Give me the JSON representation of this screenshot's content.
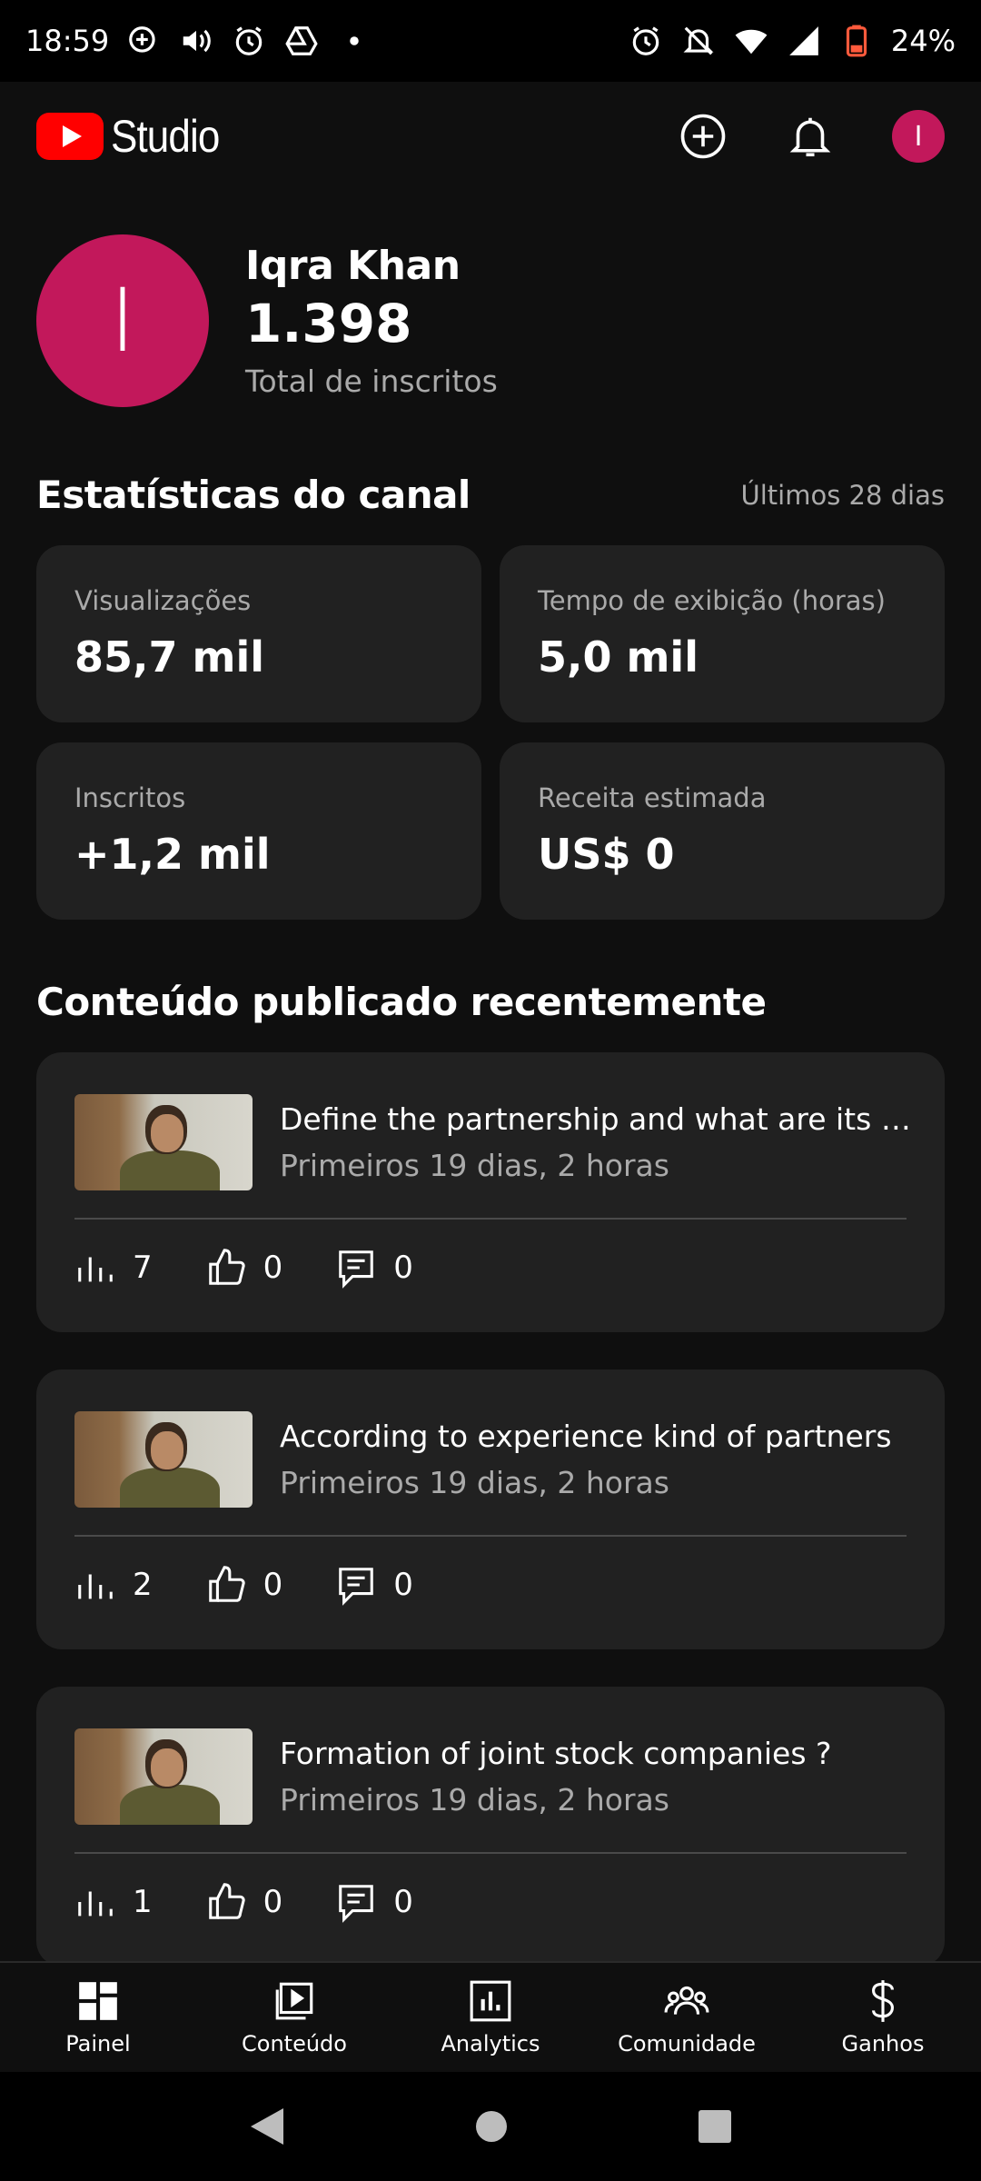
{
  "status_bar": {
    "time": "18:59",
    "battery": "24%"
  },
  "app": {
    "logo_text": "Studio",
    "avatar_letter": "I",
    "brand_color": "#ff0000",
    "avatar_color": "#c2185b"
  },
  "profile": {
    "avatar_letter": "I",
    "name": "Iqra Khan",
    "subscribers": "1.398",
    "subscribers_label": "Total de inscritos"
  },
  "stats": {
    "title": "Estatísticas do canal",
    "period": "Últimos 28 dias",
    "cards": [
      {
        "label": "Visualizações",
        "value": "85,7 mil"
      },
      {
        "label": "Tempo de exibição (horas)",
        "value": "5,0 mil"
      },
      {
        "label": "Inscritos",
        "value": "+1,2 mil"
      },
      {
        "label": "Receita estimada",
        "value": "US$ 0"
      }
    ]
  },
  "recent": {
    "title": "Conteúdo publicado recentemente",
    "videos": [
      {
        "title": "Define the partnership and what are its c...",
        "subtitle": "Primeiros 19 dias, 2 horas",
        "views": "7",
        "likes": "0",
        "comments": "0"
      },
      {
        "title": "According to experience kind of partners",
        "subtitle": "Primeiros 19 dias, 2 horas",
        "views": "2",
        "likes": "0",
        "comments": "0"
      },
      {
        "title": "Formation of joint stock companies ?",
        "subtitle": "Primeiros 19 dias, 2 horas",
        "views": "1",
        "likes": "0",
        "comments": "0"
      }
    ]
  },
  "nav": [
    {
      "label": "Painel",
      "icon": "dashboard-icon"
    },
    {
      "label": "Conteúdo",
      "icon": "content-icon"
    },
    {
      "label": "Analytics",
      "icon": "analytics-icon"
    },
    {
      "label": "Comunidade",
      "icon": "community-icon"
    },
    {
      "label": "Ganhos",
      "icon": "earn-icon"
    }
  ]
}
